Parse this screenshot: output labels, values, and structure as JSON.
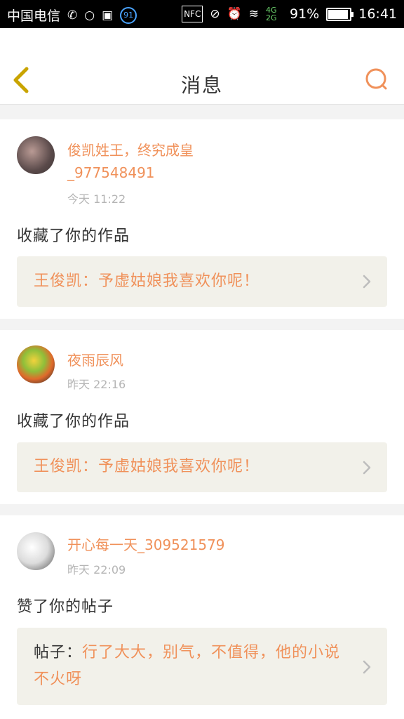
{
  "status_bar": {
    "carrier": "中国电信",
    "notification_badge": "91",
    "battery": "91%",
    "time": "16:41",
    "network": "4G 2G"
  },
  "header": {
    "title": "消息"
  },
  "messages": [
    {
      "username": "俊凯姓王，终究成皇_977548491",
      "time": "今天 11:22",
      "action": "收藏了你的作品",
      "quote_prefix": "",
      "quote": "王俊凯：予虚姑娘我喜欢你呢！"
    },
    {
      "username": "夜雨辰风",
      "time": "昨天 22:16",
      "action": "收藏了你的作品",
      "quote_prefix": "",
      "quote": "王俊凯：予虚姑娘我喜欢你呢！"
    },
    {
      "username": "开心每一天_309521579",
      "time": "昨天 22:09",
      "action": "赞了你的帖子",
      "quote_prefix": "帖子：",
      "quote": "行了大大，别气，不值得，他的小说不火呀"
    }
  ],
  "icons": {
    "back": "back-chevron-icon",
    "search": "search-icon",
    "chevron": "chevron-right-icon"
  },
  "colors": {
    "accent": "#f0915a",
    "back_arrow": "#c9a400",
    "quote_bg": "#f2f1ea"
  }
}
